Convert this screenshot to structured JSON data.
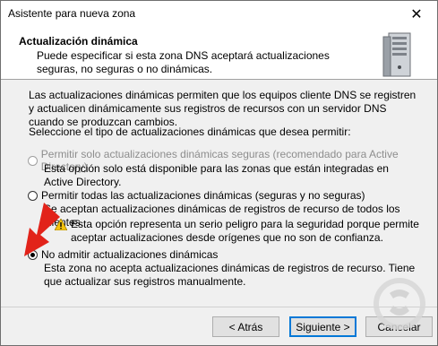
{
  "window": {
    "title": "Asistente para nueva zona",
    "close_icon": "close-icon"
  },
  "header": {
    "title": "Actualización dinámica",
    "description": "Puede especificar si esta zona DNS aceptará actualizaciones seguras, no seguras o no dinámicas.",
    "icon": "server-icon"
  },
  "body": {
    "intro": "Las actualizaciones dinámicas permiten que los equipos cliente DNS se registren y actualicen dinámicamente sus registros de recursos con un servidor DNS cuando se produzcan cambios.",
    "prompt": "Seleccione el tipo de actualizaciones dinámicas que desea permitir:",
    "options": [
      {
        "label": "Permitir solo actualizaciones dinámicas seguras (recomendado para Active Directory)",
        "description": "Esta opción solo está disponible para las zonas que están integradas en Active Directory.",
        "enabled": false,
        "selected": false
      },
      {
        "label": "Permitir todas las actualizaciones dinámicas (seguras y no seguras)",
        "description": "Se aceptan actualizaciones dinámicas de registros de recurso de todos los clientes.",
        "warning": "Esta opción representa un serio peligro para la seguridad porque permite aceptar actualizaciones desde orígenes que no son de confianza.",
        "warning_icon": "warning-icon",
        "enabled": true,
        "selected": false
      },
      {
        "label": "No admitir actualizaciones dinámicas",
        "description": "Esta zona no acepta actualizaciones dinámicas de registros de recurso. Tiene que actualizar sus registros manualmente.",
        "enabled": true,
        "selected": true
      }
    ]
  },
  "footer": {
    "back": "< Atrás",
    "next": "Siguiente >",
    "cancel": "Cancelar"
  },
  "colors": {
    "accent": "#0078d7",
    "arrow": "#e2231a",
    "disabled": "#8d8d8d"
  }
}
